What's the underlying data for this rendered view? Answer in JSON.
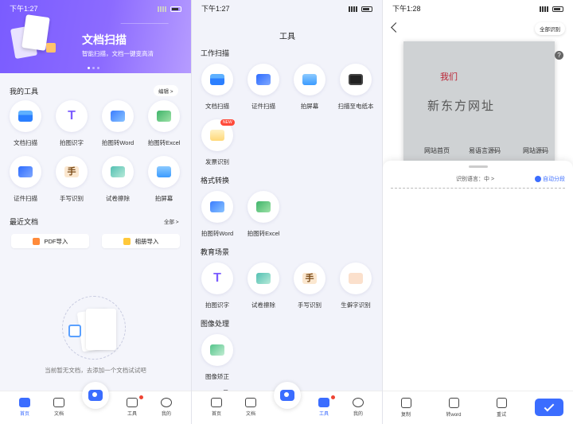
{
  "home": {
    "status": {
      "time": "下午1:27"
    },
    "banner": {
      "title": "文档扫描",
      "subtitle": "智能扫描，文档一键变高清"
    },
    "my_tools": {
      "title": "我的工具",
      "edit": "编辑 >"
    },
    "tools": [
      "文档扫描",
      "拍图识字",
      "拍图转Word",
      "拍图转Excel",
      "证件扫描",
      "手写识别",
      "试卷擦除",
      "拍屏幕"
    ],
    "recent": {
      "title": "最近文档",
      "all": "全部 >"
    },
    "imports": {
      "pdf": "PDF导入",
      "album": "相册导入"
    },
    "empty_text": "当前暂无文档，去添加一个文档试试吧"
  },
  "nav": {
    "home": "首页",
    "docs": "文档",
    "tools": "工具",
    "mine": "我的"
  },
  "tools_page": {
    "status": {
      "time": "下午1:27"
    },
    "title": "工具",
    "sections": {
      "work": "工作扫描",
      "format": "格式转换",
      "edu": "教育场景",
      "image": "图像处理",
      "pdf": "PDF工具"
    },
    "work_items": [
      "文档扫描",
      "证件扫描",
      "拍屏幕",
      "扫描至电纸本",
      "发票识别"
    ],
    "new_badge": "NEW",
    "format_items": [
      "拍图转Word",
      "拍图转Excel"
    ],
    "edu_items": [
      "拍图识字",
      "试卷擦除",
      "手写识别",
      "生僻字识别"
    ],
    "image_items": [
      "图像矫正"
    ]
  },
  "result": {
    "status": {
      "time": "下午1:28"
    },
    "all_recognize": "全部识别",
    "photo_text": {
      "line1": "我们",
      "line2": "新东方网址",
      "row": [
        "网站首页",
        "易语言源码",
        "网站源码"
      ]
    },
    "lang_label": "识别语言：中 >",
    "auto_split": "自动分段",
    "actions": {
      "copy": "复制",
      "word": "转word",
      "retry": "重试"
    }
  }
}
